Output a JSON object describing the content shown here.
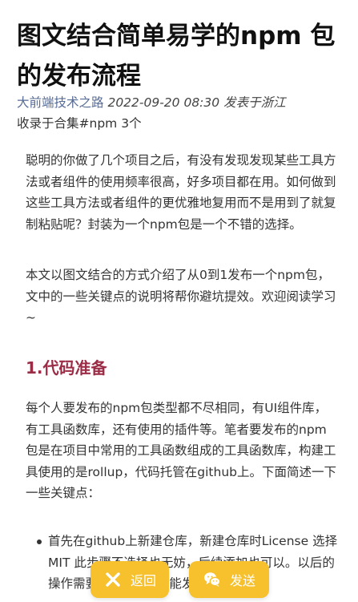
{
  "article": {
    "title": "图文结合简单易学的npm 包的发布流程",
    "meta": {
      "account": "大前端技术之路",
      "date": "2022-09-20 08:30",
      "location": "发表于浙江"
    },
    "collection": {
      "prefix": "收录于合集",
      "tag": "#npm",
      "count": "3个"
    },
    "paragraphs": [
      "聪明的你做了几个项目之后，有没有发现发现某些工具方法或者组件的使用频率很高，好多项目都在用。如何做到这些工具方法或者组件的更优雅地复用而不是用到了就复制粘贴呢？封装为一个npm包是一个不错的选择。",
      "本文以图文结合的方式介绍了从0到1发布一个npm包，文中的一些关键点的说明将帮你避坑提效。欢迎阅读学习~"
    ],
    "section_heading": "1.代码准备",
    "section_paragraph": "每个人要发布的npm包类型都不尽相同，有UI组件库，有工具函数库，还有使用的插件等。笔者要发布的npm包是在项目中常用的工具函数组成的工具函数库，构建工具使用的是rollup，代码托管在github上。下面简述一下一些关键点：",
    "bullets": [
      "首先在github上新建仓库，新建仓库时License 选择MIT 此步骤不选择也无妨，后续添加也可以。以后的操作需要有License才能发布npm包"
    ]
  },
  "floating_buttons": {
    "back_label": "返回",
    "send_label": "发送",
    "back_icon": "close-x-icon",
    "send_icon": "wechat-icon",
    "button_color": "#f6c12c"
  },
  "colors": {
    "heading_accent": "#9b2c46",
    "account_link": "#576b95"
  }
}
